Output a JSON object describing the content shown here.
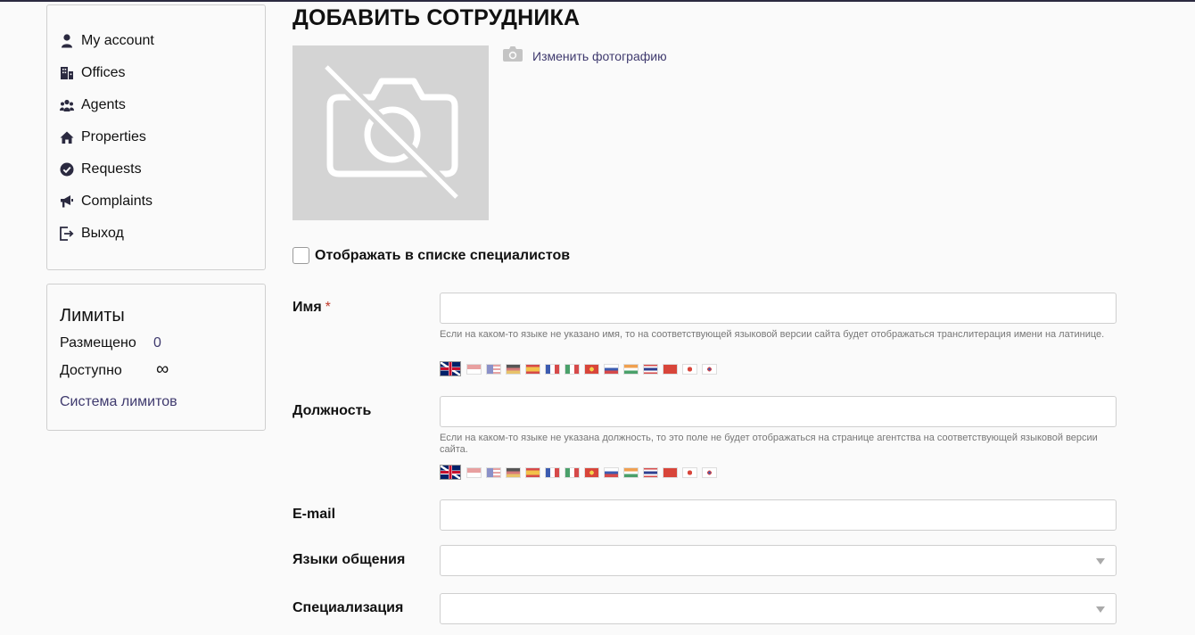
{
  "sidebar": {
    "items": [
      {
        "label": "My account",
        "icon": "user-icon"
      },
      {
        "label": "Offices",
        "icon": "building-icon"
      },
      {
        "label": "Agents",
        "icon": "people-icon"
      },
      {
        "label": "Properties",
        "icon": "home-icon"
      },
      {
        "label": "Requests",
        "icon": "check-circle-icon"
      },
      {
        "label": "Complaints",
        "icon": "megaphone-icon"
      },
      {
        "label": "Выход",
        "icon": "logout-icon"
      }
    ]
  },
  "limits": {
    "title": "Лимиты",
    "placed_label": "Размещено",
    "placed_value": "0",
    "available_label": "Доступно",
    "available_value": "∞",
    "system_link": "Система лимитов"
  },
  "page": {
    "title": "ДОБАВИТЬ СОТРУДНИКА",
    "change_photo": "Изменить фотографию",
    "show_in_list": "Отображать в списке специалистов"
  },
  "form": {
    "name_label": "Имя",
    "required_mark": "*",
    "name_hint": "Если на каком-то языке не указано имя, то на соответствующей языковой версии сайта будет отображаться транслитерация имени на латинице.",
    "position_label": "Должность",
    "position_hint": "Если на каком-то языке не указана должность, то это поле не будет отображаться на странице агентства на соответствующей языковой версии сайта.",
    "email_label": "E-mail",
    "languages_label": "Языки общения",
    "specialization_label": "Специализация"
  },
  "colors": {
    "accent": "#3f3a6e",
    "topline": "#2b2a40",
    "required": "#c0392b"
  }
}
